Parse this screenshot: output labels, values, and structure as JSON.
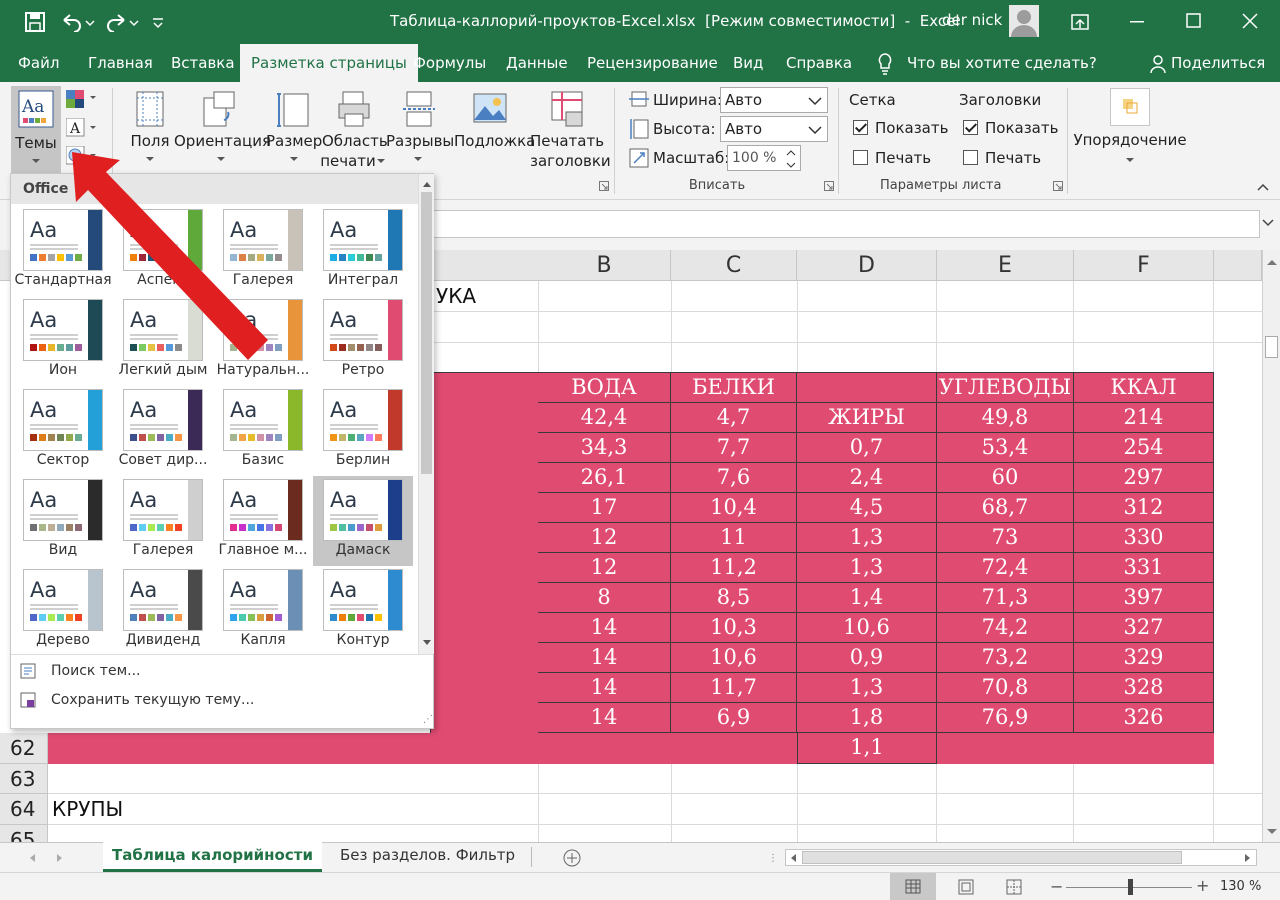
{
  "titlebar": {
    "title": "Таблица-каллорий-проуктов-Excel.xlsx  [Режим совместимости]  -  Excel",
    "user": "der nick"
  },
  "tabs": [
    "Файл",
    "Главная",
    "Вставка",
    "Разметка страницы",
    "Формулы",
    "Данные",
    "Рецензирование",
    "Вид",
    "Справка",
    "Что вы хотите сделать?",
    "Поделиться"
  ],
  "ribbon": {
    "themes": "Темы",
    "margins": "Поля",
    "orientation": "Ориентация",
    "size": "Размер",
    "print_area_1": "Область",
    "print_area_2": "печати",
    "breaks": "Разрывы",
    "background": "Подложка",
    "print_titles_1": "Печатать",
    "print_titles_2": "заголовки",
    "width_label": "Ширина:",
    "width_value": "Авто",
    "height_label": "Высота:",
    "height_value": "Авто",
    "scale_label": "Масштаб:",
    "scale_value": "100 %",
    "fit_group": "Вписать",
    "grid_title": "Сетка",
    "grid_show": "Показать",
    "grid_print": "Печать",
    "headings_title": "Заголовки",
    "headings_show": "Показать",
    "headings_print": "Печать",
    "sheet_options_group": "Параметры листа",
    "arrange": "Упорядочение"
  },
  "theme_panel": {
    "section": "Office",
    "themes": [
      "Стандартная",
      "Аспект",
      "Галерея",
      "Интеграл",
      "Ион",
      "Легкий дым",
      "Натуральн...",
      "Ретро",
      "Сектор",
      "Совет дир...",
      "Базис",
      "Берлин",
      "Вид",
      "Галерея",
      "Главное м...",
      "Дамаск",
      "Дерево",
      "Дивиденд",
      "Капля",
      "Контур"
    ],
    "search": "Поиск тем...",
    "save": "Сохранить текущую тему..."
  },
  "sheet": {
    "columns": [
      "B",
      "C",
      "D",
      "E",
      "F"
    ],
    "row_numbers": [
      "62",
      "63",
      "64",
      "65"
    ],
    "partial_title": "УКА",
    "groats_label": "КРУПЫ",
    "headers": [
      "ВОДА",
      "БЕЛКИ",
      "",
      "УГЛЕВОДЫ",
      "ККАЛ"
    ],
    "d_header": "ЖИРЫ",
    "rows": [
      [
        "42,4",
        "4,7",
        "",
        "49,8",
        "214"
      ],
      [
        "34,3",
        "7,7",
        "0,7",
        "53,4",
        "254"
      ],
      [
        "26,1",
        "7,6",
        "2,4",
        "60",
        "297"
      ],
      [
        "17",
        "10,4",
        "4,5",
        "68,7",
        "312"
      ],
      [
        "12",
        "11",
        "1,3",
        "73",
        "330"
      ],
      [
        "12",
        "11,2",
        "1,3",
        "72,4",
        "331"
      ],
      [
        "8",
        "8,5",
        "1,4",
        "71,3",
        "397"
      ],
      [
        "14",
        "10,3",
        "10,6",
        "74,2",
        "327"
      ],
      [
        "14",
        "10,6",
        "0,9",
        "73,2",
        "329"
      ],
      [
        "14",
        "11,7",
        "1,3",
        "70,8",
        "328"
      ],
      [
        "14",
        "6,9",
        "1,8",
        "76,9",
        "326"
      ]
    ],
    "row62_d": "1,1"
  },
  "sheet_tabs": [
    "Таблица калорийности",
    "Без разделов. Фильтр"
  ],
  "status": {
    "zoom": "130 %"
  },
  "colors": {
    "excel_green": "#217346",
    "cell_fill": "#e04b72",
    "arrow": "#e02020"
  }
}
